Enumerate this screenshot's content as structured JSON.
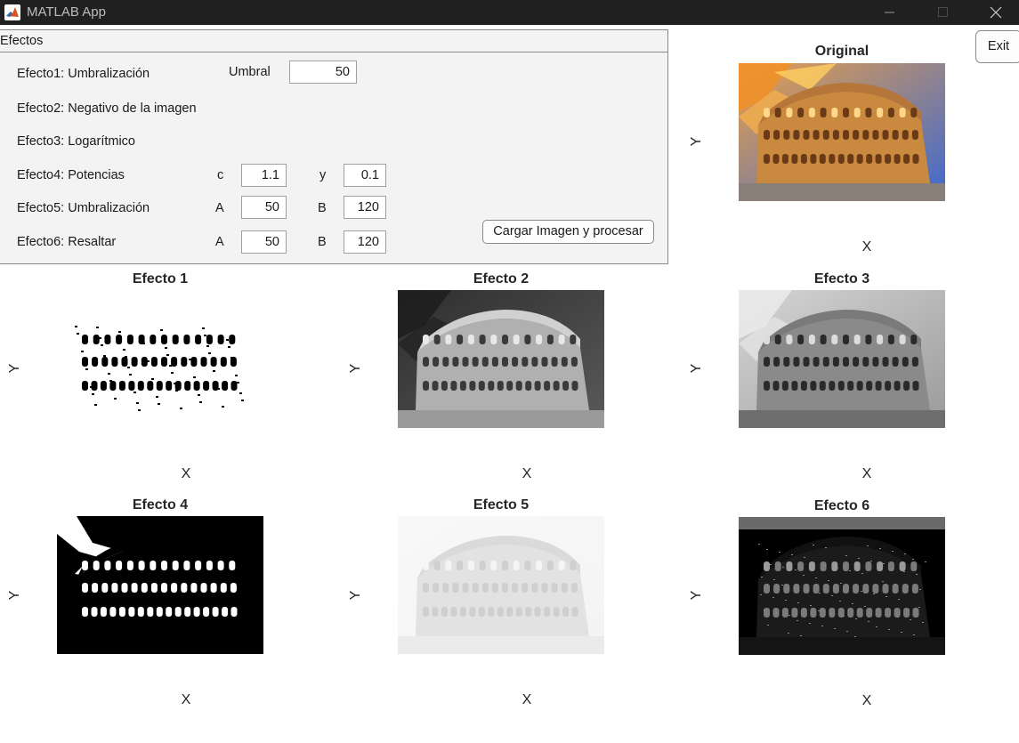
{
  "window": {
    "title": "MATLAB App"
  },
  "panel": {
    "title": "Efectos",
    "rows": [
      {
        "label": "Efecto1: Umbralización",
        "param1_label": "Umbral",
        "param1_value": "50"
      },
      {
        "label": "Efecto2: Negativo de la imagen"
      },
      {
        "label": "Efecto3: Logarítmico"
      },
      {
        "label": "Efecto4: Potencias",
        "param1_label": "c",
        "param1_value": "1.1",
        "param2_label": "y",
        "param2_value": "0.1"
      },
      {
        "label": "Efecto5: Umbralización",
        "param1_label": "A",
        "param1_value": "50",
        "param2_label": "B",
        "param2_value": "120"
      },
      {
        "label": "Efecto6: Resaltar",
        "param1_label": "A",
        "param1_value": "50",
        "param2_label": "B",
        "param2_value": "120"
      }
    ],
    "process_button": "Cargar Imagen y procesar"
  },
  "exit_button": "Exit",
  "axes": [
    {
      "title": "Original",
      "xlabel": "X",
      "ylabel": "Y",
      "style": "color"
    },
    {
      "title": "Efecto 1",
      "xlabel": "X",
      "ylabel": "Y",
      "style": "threshold"
    },
    {
      "title": "Efecto 2",
      "xlabel": "X",
      "ylabel": "Y",
      "style": "negative"
    },
    {
      "title": "Efecto 3",
      "xlabel": "X",
      "ylabel": "Y",
      "style": "gray"
    },
    {
      "title": "Efecto 4",
      "xlabel": "X",
      "ylabel": "Y",
      "style": "power"
    },
    {
      "title": "Efecto 5",
      "xlabel": "X",
      "ylabel": "Y",
      "style": "faded"
    },
    {
      "title": "Efecto 6",
      "xlabel": "X",
      "ylabel": "Y",
      "style": "edges"
    }
  ],
  "colors": {
    "titlebar": "#202020",
    "panel_bg": "#f3f3f3",
    "sky_top": "#3b6fd6",
    "sky_sunset": "#f4a23a",
    "stone": "#c98a4a"
  }
}
